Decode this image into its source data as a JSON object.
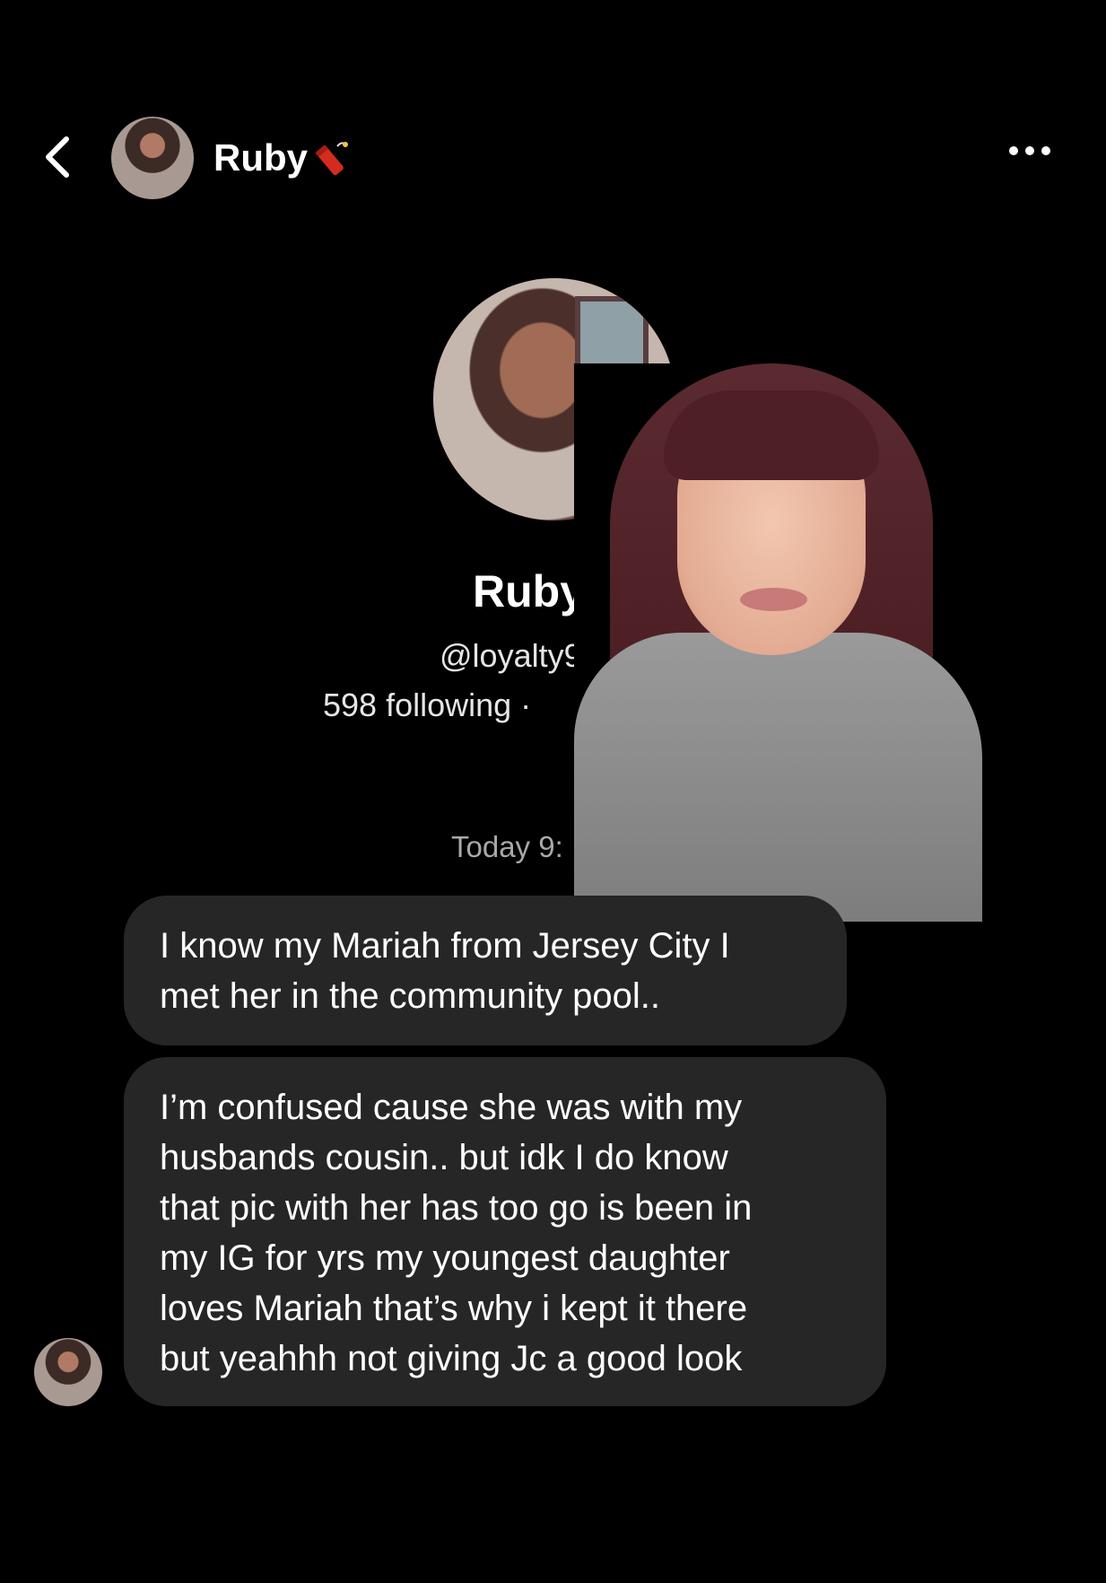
{
  "header": {
    "back_icon": "chevron-left-icon",
    "name": "Ruby",
    "name_emoji": "dynamite-icon",
    "more_icon": "more-horizontal-icon"
  },
  "profile": {
    "name": "Ruby",
    "handle": "@loyalty90",
    "stats": "598 following · "
  },
  "conversation": {
    "timestamp": "Today 9:",
    "messages": [
      {
        "text": "I know my Mariah from Jersey City I\nmet her in the community pool.."
      },
      {
        "text": "I’m confused cause she was with my\nhusbands cousin.. but idk I do know\nthat pic with her has too go is been in\nmy IG for yrs my youngest daughter\nloves Mariah that’s why i kept it there\nbut yeahhh not giving Jc a good look"
      }
    ]
  },
  "colors": {
    "background": "#000000",
    "bubble": "#262626",
    "text": "#ffffff",
    "secondary_text": "#a8a8a8",
    "dynamite_red": "#d42b1e"
  }
}
